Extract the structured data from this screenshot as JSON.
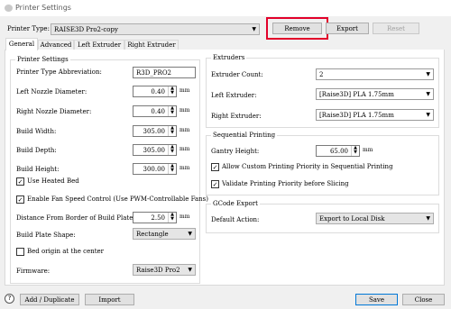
{
  "window": {
    "title": "Printer Settings"
  },
  "header": {
    "printer_type_label": "Printer Type:",
    "printer_type_value": "RAISE3D Pro2-copy",
    "remove_label": "Remove",
    "export_label": "Export",
    "reset_label": "Reset"
  },
  "tabs": [
    "General",
    "Advanced",
    "Left Extruder",
    "Right Extruder"
  ],
  "printer_settings": {
    "title": "Printer Settings",
    "abbreviation_label": "Printer Type Abbreviation:",
    "abbreviation_value": "R3D_PRO2",
    "left_nozzle_label": "Left Nozzle Diameter:",
    "left_nozzle_value": "0.40",
    "right_nozzle_label": "Right Nozzle Diameter:",
    "right_nozzle_value": "0.40",
    "build_width_label": "Build Width:",
    "build_width_value": "305.00",
    "build_depth_label": "Build Depth:",
    "build_depth_value": "305.00",
    "build_height_label": "Build Height:",
    "build_height_value": "300.00",
    "unit_mm": "mm",
    "heated_bed_label": "Use Heated Bed",
    "heated_bed_checked": true,
    "fan_speed_label": "Enable Fan Speed Control (Use PWM-Controllable Fans)",
    "fan_speed_checked": true,
    "distance_label": "Distance From Border of Build Plate:",
    "distance_value": "2.50",
    "plate_shape_label": "Build Plate Shape:",
    "plate_shape_value": "Rectangle",
    "origin_center_label": "Bed origin at the center",
    "origin_center_checked": false,
    "firmware_label": "Firmware:",
    "firmware_value": "Raise3D Pro2"
  },
  "extruders": {
    "title": "Extruders",
    "count_label": "Extruder Count:",
    "count_value": "2",
    "left_label": "Left Extruder:",
    "left_value": "[Raise3D] PLA 1.75mm",
    "right_label": "Right Extruder:",
    "right_value": "[Raise3D] PLA 1.75mm"
  },
  "sequential": {
    "title": "Sequential Printing",
    "gantry_label": "Gantry Height:",
    "gantry_value": "65.00",
    "custom_priority_label": "Allow Custom Printing Priority in Sequential Printing",
    "custom_priority_checked": true,
    "validate_label": "Validate Printing Priority before Slicing",
    "validate_checked": true
  },
  "gcode": {
    "title": "GCode Export",
    "default_action_label": "Default Action:",
    "default_action_value": "Export to Local Disk"
  },
  "footer": {
    "help_glyph": "?",
    "add_label": "Add / Duplicate",
    "import_label": "Import",
    "save_label": "Save",
    "close_label": "Close"
  },
  "glyphs": {
    "check": "✓",
    "dropdown": "▼",
    "spin_up": "▲",
    "spin_down": "▼"
  },
  "colors": {
    "highlight": "#e2002a",
    "accent": "#0078d7"
  }
}
